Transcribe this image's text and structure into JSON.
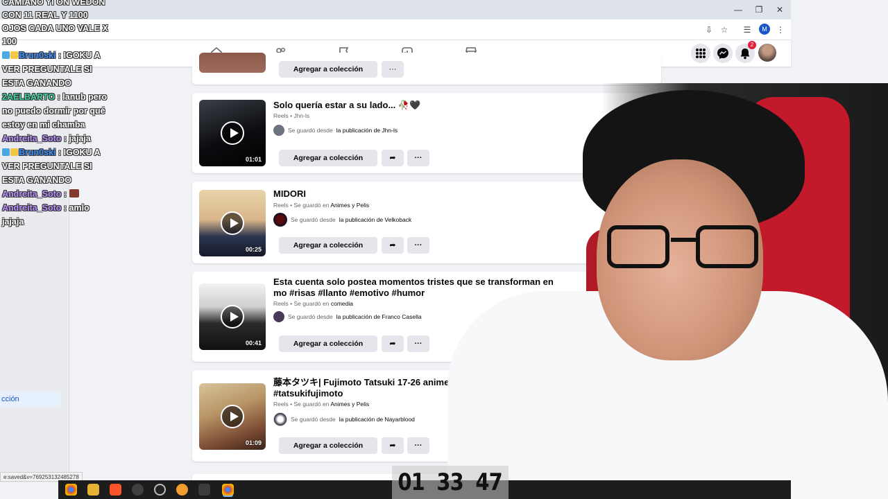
{
  "browser": {
    "window_controls": {
      "minimize": "—",
      "restore": "❐",
      "close": "✕"
    },
    "profile_letter": "M"
  },
  "fbnav": {
    "notification_count": "2"
  },
  "chat": {
    "overlay_text": "CAMIANO YI ON WEDON CON 11 REAL Y 1100 OJOS CADA UNO VALE X 100",
    "messages": [
      {
        "user": "Brun0ski",
        "text": ": IGOKU A VER PREGUNTALE SI ESTA GANANDO",
        "color": "blue"
      },
      {
        "user": "2AELBARTO",
        "text": ": lanub pero no puedo dormir por qué estoy en mi chamba",
        "color": "green"
      },
      {
        "user": "Andreita_Soto",
        "text": ": jajaja",
        "color": "purple"
      },
      {
        "user": "Brun0ski",
        "text": ": IGOKU A VER PREGUNTALE SI ESTA GANANDO",
        "color": "blue"
      },
      {
        "user": "Andreita_Soto",
        "text": ": ",
        "color": "purple"
      },
      {
        "user": "Andreita_Soto",
        "text": ": amlo jajaja",
        "color": "purple"
      }
    ]
  },
  "left_panel": {
    "selected_item": "cción"
  },
  "saved": {
    "top_partial": {
      "collection_button": "Agregar a colección",
      "more_label": "···"
    },
    "items": [
      {
        "title": "Solo quería estar a su lado... 🥀🖤",
        "type": "Reels",
        "meta_suffix": "Jhn-ls",
        "saved_prefix": "Se guardó desde",
        "saved_source": "la publicación de Jhn-ls",
        "duration": "01:01",
        "collection_button": "Agregar a colección",
        "share_label": "➦",
        "more_label": "···"
      },
      {
        "title": "MIDORI",
        "type": "Reels",
        "meta_suffix": "Se guardó en",
        "meta_collection": "Animes y Pelis",
        "saved_prefix": "Se guardó desde",
        "saved_source": "la publicación de Velkoback",
        "duration": "00:25",
        "collection_button": "Agregar a colección",
        "share_label": "➦",
        "more_label": "···"
      },
      {
        "title": "Esta cuenta solo postea momentos tristes que se transforman en mo #risas #llanto #emotivo #humor",
        "type": "Reels",
        "meta_suffix": "Se guardó en",
        "meta_collection": "comedia",
        "saved_prefix": "Se guardó desde",
        "saved_source": "la publicación de Franco Casella",
        "duration": "00:41",
        "collection_button": "Agregar a colección",
        "share_label": "➦",
        "more_label": "···"
      },
      {
        "title": "藤本タツキ| Fujimoto Tatsuki 17-26 anime #an #tatsukifujimoto",
        "type": "Reels",
        "meta_suffix": "Se guardó en",
        "meta_collection": "Animes y Pelis",
        "saved_prefix": "Se guardó desde",
        "saved_source": "la publicación de Nayarblood",
        "duration": "01:09",
        "collection_button": "Agregar a colección",
        "share_label": "➦",
        "more_label": "···"
      }
    ]
  },
  "status_url": "e:saved&v=769253132485278",
  "timer": {
    "hours": "01",
    "minutes": "33",
    "seconds": "47"
  },
  "colors": {
    "fb_blue": "#1a56c9",
    "badge_red": "#e41e3f",
    "chair_red": "#c21a2a"
  }
}
